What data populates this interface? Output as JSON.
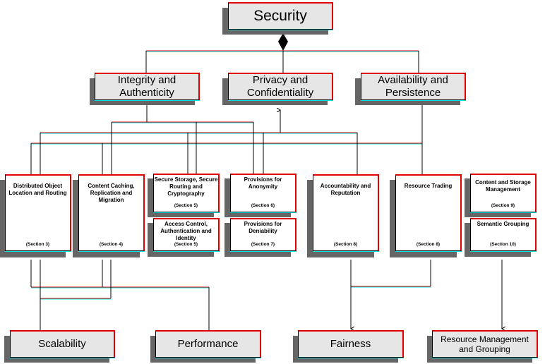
{
  "root": {
    "label": "Security"
  },
  "goals": [
    {
      "label": "Integrity and Authenticity"
    },
    {
      "label": "Privacy and Confidentiality"
    },
    {
      "label": "Availability and Persistence"
    }
  ],
  "components": [
    {
      "label": "Distributed Object Location and Routing",
      "section": "(Section 3)"
    },
    {
      "label": "Content Caching, Replication and Migration",
      "section": "(Section 4)"
    },
    {
      "label": "Secure Storage, Secure Routing and Cryptography",
      "section": "(Section 5)"
    },
    {
      "label": "Access Control, Authentication and Identity",
      "section": "(Section 5)"
    },
    {
      "label": "Provisions for Anonymity",
      "section": "(Section 6)"
    },
    {
      "label": "Provisions for Deniability",
      "section": "(Section 7)"
    },
    {
      "label": "Accountability and Reputation",
      "section": "(Section 8)"
    },
    {
      "label": "Resource Trading",
      "section": "(Section 8)"
    },
    {
      "label": "Content and Storage Management",
      "section": "(Section 9)"
    },
    {
      "label": "Semantic Grouping",
      "section": "(Section 10)"
    }
  ],
  "qualities": [
    {
      "label": "Scalability"
    },
    {
      "label": "Performance"
    },
    {
      "label": "Fairness"
    },
    {
      "label": "Resource Management and Grouping"
    }
  ],
  "colors": {
    "line_red": "#e00000",
    "line_black": "#000000",
    "shadow": "#666666",
    "box_fill": "#e6e6e6",
    "highlight": "#00e0e0"
  }
}
